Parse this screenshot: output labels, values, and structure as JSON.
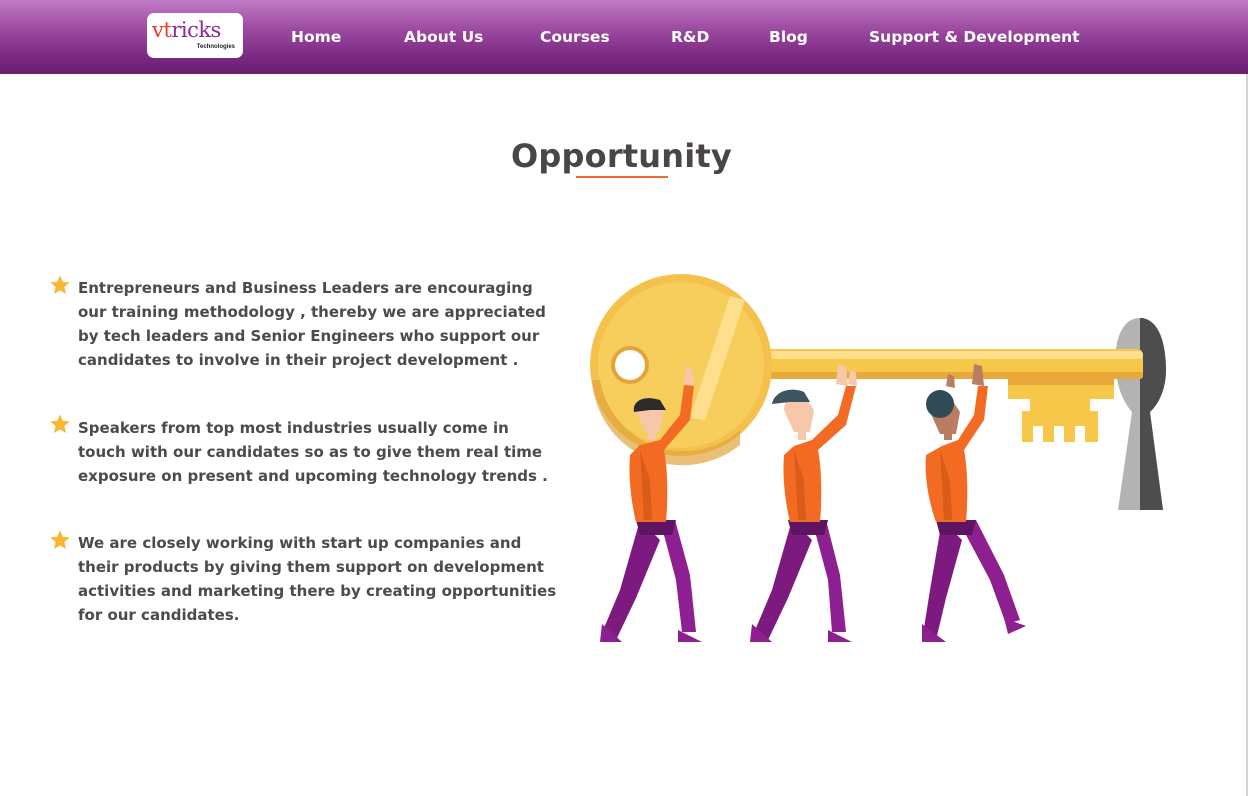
{
  "navbar": {
    "logo": {
      "text_a": "vt",
      "text_b": "ricks",
      "subtitle": "Technologies"
    },
    "items": [
      {
        "label": "Home"
      },
      {
        "label": "About Us"
      },
      {
        "label": "Courses"
      },
      {
        "label": "R&D"
      },
      {
        "label": "Blog"
      },
      {
        "label": "Support & Development"
      }
    ]
  },
  "main": {
    "title": "Opportunity",
    "bullets": [
      {
        "icon": "star-icon",
        "text": "Entrepreneurs and Business Leaders are encouraging our training methodology , thereby we are appreciated by tech leaders and Senior Engineers who support our candidates to involve in their project development ."
      },
      {
        "icon": "star-icon",
        "text": "Speakers from top most industries usually come in touch with our candidates so as to give them real time exposure on present and upcoming technology trends ."
      },
      {
        "icon": "star-icon",
        "text": "We are closely working with start up companies and their products by giving them support on development activities and marketing there by creating opportunities for our candidates."
      }
    ],
    "illustration": "people-carrying-key-illustration"
  },
  "colors": {
    "nav_gradient_top": "#c27cc6",
    "nav_gradient_bottom": "#6a1f6f",
    "accent_orange": "#ef6a2c",
    "star": "#f8b733",
    "text": "#4b4b4b"
  }
}
